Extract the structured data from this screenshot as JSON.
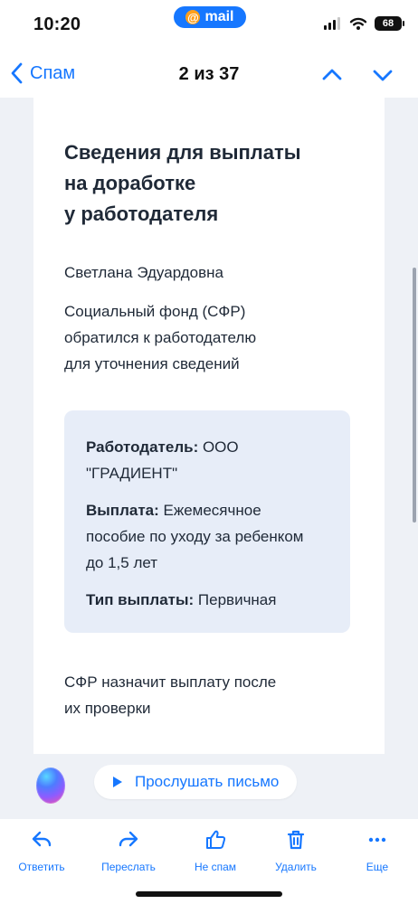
{
  "status_bar": {
    "time": "10:20",
    "mail_label": "mail",
    "mail_icon_text": "@",
    "battery": "68"
  },
  "header": {
    "back_label": "Спам",
    "counter": "2 из 37"
  },
  "letter": {
    "title": "Сведения для выплаты\nна доработке\nу работодателя",
    "greeting": "Светлана Эдуардовна",
    "intro": "Социальный фонд (СФР)\nобратился к работодателю\nдля уточнения сведений",
    "details": {
      "employer_label": "Работодатель:",
      "employer_value": " ООО\n\"ГРАДИЕНТ\"",
      "payment_label": "Выплата:",
      "payment_value": " Ежемесячное\nпособие по уходу за ребенком\nдо 1,5 лет",
      "type_label": "Тип выплаты:",
      "type_value": " Первичная"
    },
    "footer": "СФР назначит выплату после\nих проверки"
  },
  "assistant": {
    "listen_label": "Прослушать письмо"
  },
  "toolbar": {
    "reply": "Ответить",
    "forward": "Переслать",
    "not_spam": "Не спам",
    "delete": "Удалить",
    "more": "Еще"
  },
  "icons": {
    "back": "chevron-left-icon",
    "up": "chevron-up-icon",
    "down": "chevron-down-icon",
    "play": "play-icon",
    "reply": "reply-icon",
    "forward": "forward-icon",
    "not_spam": "thumbs-up-icon",
    "delete": "trash-icon",
    "more": "more-icon"
  },
  "colors": {
    "accent": "#1677ff",
    "page_background": "#eef1f6",
    "details_background": "#e7edf8",
    "text": "#1f2937"
  }
}
